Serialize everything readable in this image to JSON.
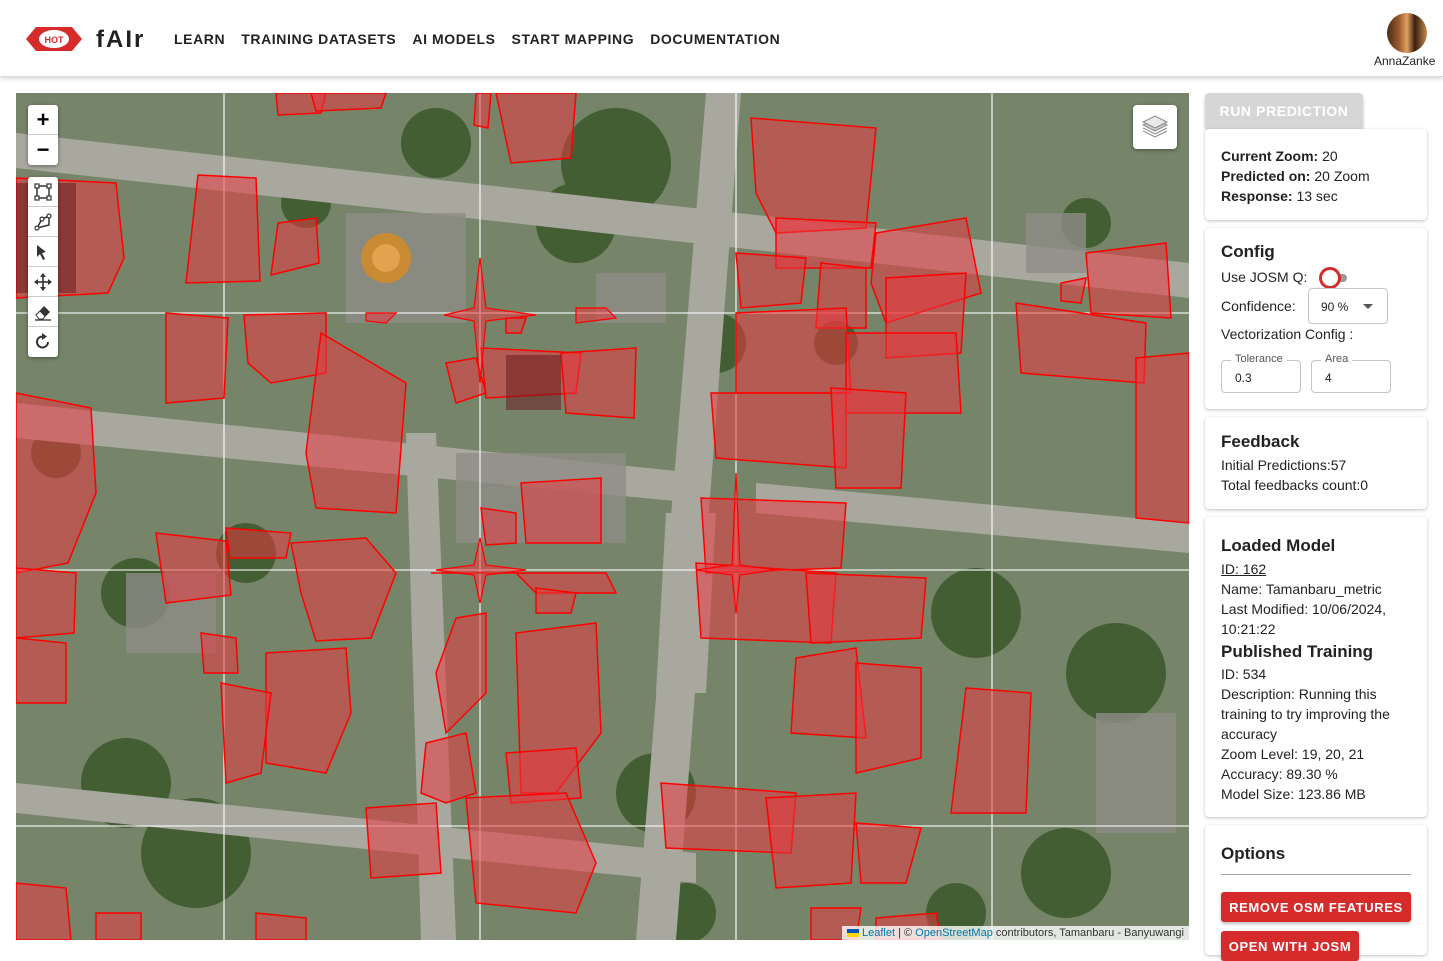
{
  "header": {
    "logo_text": "HOT",
    "brand": "fAIr",
    "nav": [
      "LEARN",
      "TRAINING DATASETS",
      "AI MODELS",
      "START MAPPING",
      "DOCUMENTATION"
    ],
    "username": "AnnaZanke"
  },
  "map": {
    "zoom_in": "+",
    "zoom_out": "−",
    "draw_tools": [
      "rectangle-draw-icon",
      "polygon-draw-icon",
      "snapping-icon",
      "move-icon",
      "eraser-icon",
      "rotate-icon"
    ],
    "attribution": {
      "leaflet": "Leaflet",
      "sep": " | © ",
      "osm": "OpenStreetMap",
      "rest": " contributors, Tamanbaru - Banyuwangi"
    }
  },
  "sidebar": {
    "run_button": "RUN PREDICTION",
    "stats": {
      "zoom_label": "Current Zoom:",
      "zoom_value": " 20",
      "predicted_label": "Predicted on:",
      "predicted_value": " 20 Zoom",
      "response_label": "Response:",
      "response_value": " 13 sec"
    },
    "config": {
      "title": "Config",
      "josm_label": "Use JOSM Q:",
      "confidence_label": "Confidence:",
      "confidence_value": "90 %",
      "vectorization_label": "Vectorization Config :",
      "tolerance_label": "Tolerance",
      "tolerance_value": "0.3",
      "area_label": "Area",
      "area_value": "4"
    },
    "feedback": {
      "title": "Feedback",
      "initial": "Initial Predictions:57",
      "total": "Total feedbacks count:0"
    },
    "model": {
      "title": "Loaded Model",
      "id": "ID: 162",
      "name": "Name: Tamanbaru_metric",
      "modified": "Last Modified: 10/06/2024,",
      "modified_time": "10:21:22",
      "training_title": "Published Training",
      "training_id": "ID: 534",
      "desc1": "Description: Running this",
      "desc2": "training to try improving the",
      "desc3": "accuracy",
      "zoom_level": "Zoom Level: 19, 20, 21",
      "accuracy": "Accuracy: 89.30 %",
      "size": "Model Size: 123.86 MB"
    },
    "options": {
      "title": "Options",
      "remove_button": "REMOVE OSM FEATURES",
      "second_button": "OPEN WITH JOSM"
    }
  },
  "colors": {
    "accent": "#d52b2b",
    "prediction_fill": "#e8393f",
    "prediction_stroke": "#ff0000",
    "disabled": "#d6d6d6"
  }
}
